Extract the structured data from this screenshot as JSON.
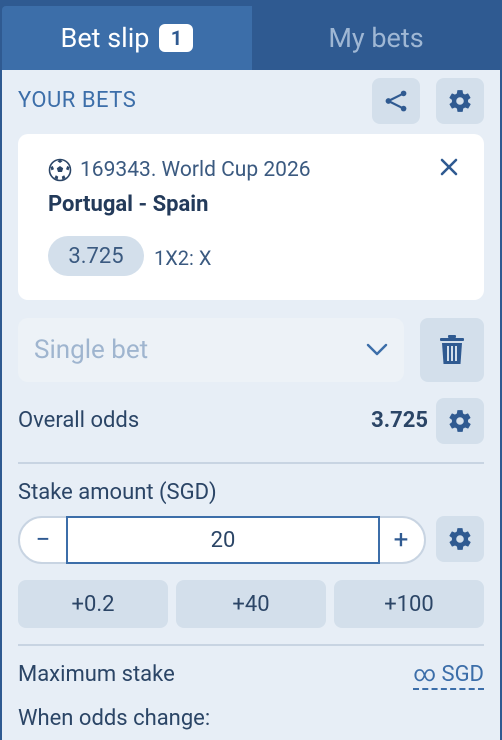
{
  "tabs": {
    "bet_slip": "Bet slip",
    "bet_slip_count": "1",
    "my_bets": "My bets"
  },
  "your_bets": {
    "title": "YOUR BETS"
  },
  "selection": {
    "event": "169343. World Cup 2026",
    "match": "Portugal - Spain",
    "odds": "3.725",
    "market": "1X2: X"
  },
  "bet_type": {
    "value": "Single bet"
  },
  "overall_odds": {
    "label": "Overall odds",
    "value": "3.725"
  },
  "stake": {
    "label": "Stake amount (SGD)",
    "minus": "−",
    "plus": "+",
    "value": "20",
    "quick": [
      "+0.2",
      "+40",
      "+100"
    ]
  },
  "maximum_stake": {
    "label": "Maximum stake",
    "value": "∞ SGD"
  },
  "odds_change": {
    "label": "When odds change:"
  },
  "colors": {
    "primary": "#2f5a91",
    "active_tab": "#3c6ea9",
    "background": "#e7eef6",
    "button_bg": "#d3dfeb"
  }
}
